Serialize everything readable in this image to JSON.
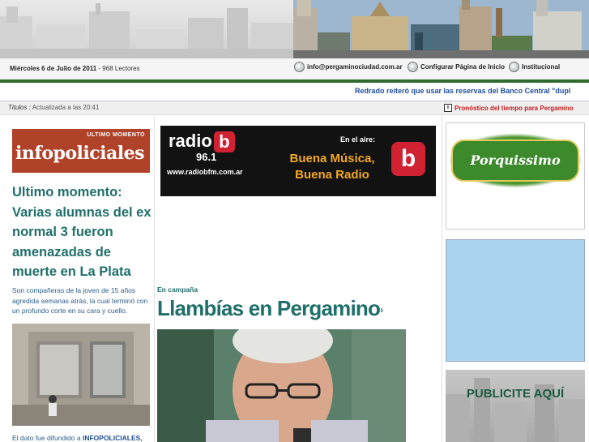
{
  "header": {
    "date": "Miércoles 6 de Julio de 2011",
    "readers": "- 968 Lectores",
    "links": [
      {
        "label": "info@pergaminociudad.com.ar",
        "icon": "email-icon"
      },
      {
        "label": "Configurar Página de Inicio",
        "icon": "home-icon"
      },
      {
        "label": "Institucional",
        "icon": "info-circle-icon"
      }
    ],
    "ticker": "Redrado reiteró que usar las reservas del Banco Central \"dupl"
  },
  "titles_bar": {
    "label": "Titulos :",
    "updated": "Actualizada a las 20:41",
    "forecast_link": "Pronóstico del tiempo para Pergamino"
  },
  "left_column": {
    "banner_top": "ULTIMO MOMENTO",
    "banner_main": "infopoliciales",
    "headline": "Ultimo momento: Varias alumnas del ex normal 3 fueron amenazadas de muerte en La Plata",
    "summary": "Son compañeras de la joven de 15 años agredida semanas atrás, la cual terminó con un profundo corte en su cara y cuello.",
    "caption_prefix": "El dato fue difundido a",
    "caption_bold": "INFOPOLICIALES,"
  },
  "radio_ad": {
    "brand": "radio",
    "brand_letter": "b",
    "frequency": "96.1",
    "url": "www.radiobfm.com.ar",
    "on_air": "En el aire:",
    "slogan_line1": "Buena Música,",
    "slogan_line2": "Buena Radio",
    "big_letter": "b"
  },
  "main_story": {
    "section": "En campaña",
    "headline": "Llambías en Pergamino",
    "arrow": "›"
  },
  "right_column": {
    "porquissimo": "Porquissimo",
    "publicite": "PUBLICITE AQUÍ"
  },
  "colors": {
    "accent_green": "#1f6f6a",
    "header_bar": "#2f6b2f",
    "ticker_blue": "#1e4f9b",
    "alert_red": "#c21b1b"
  }
}
